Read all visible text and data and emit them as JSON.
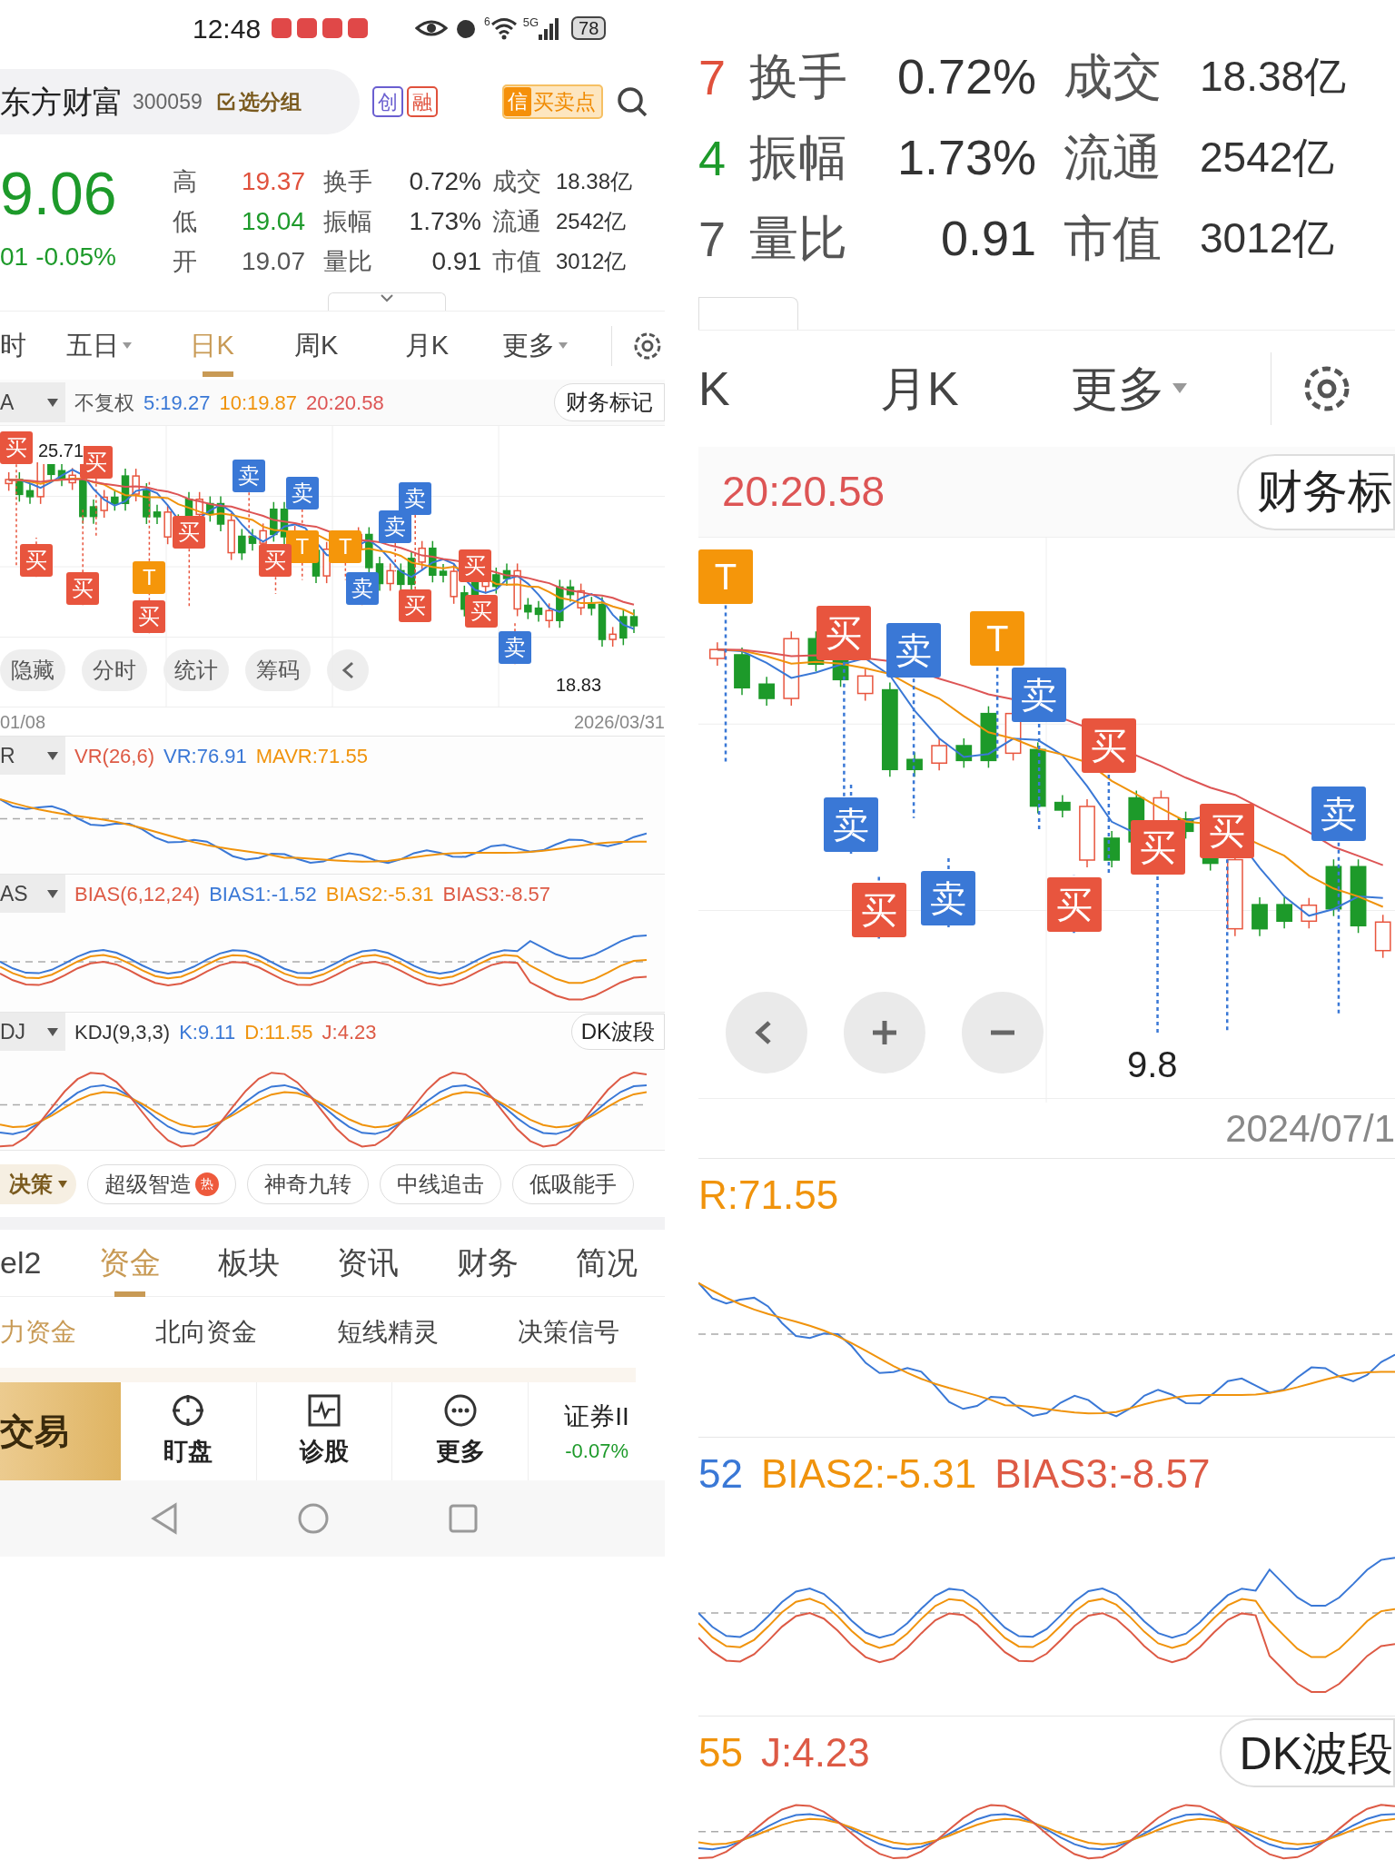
{
  "status_bar": {
    "time": "12:48",
    "network": "5G",
    "wifi_badge": "6",
    "battery": "78"
  },
  "left": {
    "header": {
      "name": "东方财富",
      "code": "300059",
      "group_button": "选分组",
      "badges": [
        {
          "label": "创",
          "color": "#6a5fd0"
        },
        {
          "label": "融",
          "color": "#e0513c"
        }
      ],
      "signal_icon_label": "信",
      "signal_button": "买卖点"
    },
    "quote": {
      "price": "9.06",
      "change": "01",
      "change_pct": "-0.05%",
      "stats": [
        [
          {
            "label": "高",
            "value": "19.37",
            "color": "#e0513c"
          },
          {
            "label": "换手",
            "value": "0.72%",
            "color": "#333333"
          },
          {
            "label": "成交",
            "value": "18.38亿",
            "color": "#333333"
          }
        ],
        [
          {
            "label": "低",
            "value": "19.04",
            "color": "#1d9a2a"
          },
          {
            "label": "振幅",
            "value": "1.73%",
            "color": "#333333"
          },
          {
            "label": "流通",
            "value": "2542亿",
            "color": "#333333"
          }
        ],
        [
          {
            "label": "开",
            "value": "19.07",
            "color": "#555555"
          },
          {
            "label": "量比",
            "value": "0.91",
            "color": "#333333"
          },
          {
            "label": "市值",
            "value": "3012亿",
            "color": "#333333"
          }
        ]
      ]
    },
    "periods": [
      {
        "label": "时",
        "selected": false,
        "dropdown": false
      },
      {
        "label": "五日",
        "selected": false,
        "dropdown": true
      },
      {
        "label": "日K",
        "selected": true,
        "dropdown": false
      },
      {
        "label": "周K",
        "selected": false,
        "dropdown": false
      },
      {
        "label": "月K",
        "selected": false,
        "dropdown": false
      },
      {
        "label": "更多",
        "selected": false,
        "dropdown": true
      }
    ],
    "chart_header": {
      "selector": "A",
      "adjust": "不复权",
      "ma": [
        {
          "text": "5:19.27",
          "color": "#3a78d6"
        },
        {
          "text": "10:19.87",
          "color": "#f0930c"
        },
        {
          "text": "20:20.58",
          "color": "#dd5555"
        }
      ],
      "button": "财务标记"
    },
    "main_chart": {
      "max_label": "25.71",
      "min_label": "18.83",
      "markers": [
        {
          "kind": "buy",
          "label": "买"
        },
        {
          "kind": "buy",
          "label": "买"
        },
        {
          "kind": "buy",
          "label": "买"
        },
        {
          "kind": "buy",
          "label": "买"
        },
        {
          "kind": "buy",
          "label": "买"
        },
        {
          "kind": "sell",
          "label": "卖"
        },
        {
          "kind": "sell",
          "label": "卖"
        },
        {
          "kind": "t",
          "label": "T"
        },
        {
          "kind": "t",
          "label": "T"
        },
        {
          "kind": "buy",
          "label": "买"
        },
        {
          "kind": "buy",
          "label": "买"
        },
        {
          "kind": "sell",
          "label": "卖"
        },
        {
          "kind": "sell",
          "label": "卖"
        },
        {
          "kind": "buy",
          "label": "买"
        },
        {
          "kind": "sell",
          "label": "卖"
        },
        {
          "kind": "buy",
          "label": "买"
        },
        {
          "kind": "buy",
          "label": "买"
        },
        {
          "kind": "t",
          "label": "T"
        },
        {
          "kind": "sell",
          "label": "卖"
        }
      ],
      "tools": [
        "隐藏",
        "分时",
        "统计",
        "筹码"
      ],
      "dates": [
        "01/08",
        "2026/03/31"
      ]
    },
    "indicators": [
      {
        "selector": "R",
        "title": {
          "text": "VR(26,6)",
          "color": "#dd5a45"
        },
        "values": [
          {
            "text": "VR:76.91",
            "color": "#3a78d6"
          },
          {
            "text": "MAVR:71.55",
            "color": "#f0930c"
          }
        ]
      },
      {
        "selector": "AS",
        "title": {
          "text": "BIAS(6,12,24)",
          "color": "#dd5a45"
        },
        "values": [
          {
            "text": "BIAS1:-1.52",
            "color": "#3a78d6"
          },
          {
            "text": "BIAS2:-5.31",
            "color": "#f0930c"
          },
          {
            "text": "BIAS3:-8.57",
            "color": "#dd5a45"
          }
        ]
      },
      {
        "selector": "DJ",
        "title": {
          "text": "KDJ(9,3,3)",
          "color": "#333333"
        },
        "values": [
          {
            "text": "K:9.11",
            "color": "#3a78d6"
          },
          {
            "text": "D:11.55",
            "color": "#f0930c"
          },
          {
            "text": "J:4.23",
            "color": "#dd5a45"
          }
        ],
        "button": "DK波段"
      }
    ],
    "strategy": {
      "dropdown": "决策",
      "chips": [
        {
          "label": "超级智造",
          "hot": "热"
        },
        {
          "label": "神奇九转"
        },
        {
          "label": "中线追击"
        },
        {
          "label": "低吸能手"
        }
      ]
    },
    "tabs": [
      {
        "label": "el2",
        "selected": false
      },
      {
        "label": "资金",
        "selected": true
      },
      {
        "label": "板块",
        "selected": false
      },
      {
        "label": "资讯",
        "selected": false
      },
      {
        "label": "财务",
        "selected": false
      },
      {
        "label": "简况",
        "selected": false
      }
    ],
    "subtabs": [
      {
        "label": "力资金",
        "selected": true
      },
      {
        "label": "北向资金",
        "selected": false
      },
      {
        "label": "短线精灵",
        "selected": false
      },
      {
        "label": "决策信号",
        "selected": false
      }
    ],
    "bottom_bar": {
      "trade": "交易",
      "actions": [
        {
          "label": "盯盘"
        },
        {
          "label": "诊股"
        },
        {
          "label": "更多"
        }
      ],
      "index_name": "证券II",
      "index_change": "-0.07%"
    }
  },
  "right": {
    "stats": [
      {
        "cut": "7",
        "color": "#e0513c",
        "pairs": [
          {
            "label": "换手",
            "value": "0.72%"
          },
          {
            "label": "成交",
            "value": "18.38亿"
          }
        ]
      },
      {
        "cut": "4",
        "color": "#1d9a2a",
        "pairs": [
          {
            "label": "振幅",
            "value": "1.73%"
          },
          {
            "label": "流通",
            "value": "2542亿"
          }
        ]
      },
      {
        "cut": "7",
        "color": "#555555",
        "pairs": [
          {
            "label": "量比",
            "value": "0.91"
          },
          {
            "label": "市值",
            "value": "3012亿"
          }
        ]
      }
    ],
    "periods": [
      {
        "label": "K",
        "dropdown": false
      },
      {
        "label": "月K",
        "dropdown": false
      },
      {
        "label": "更多",
        "dropdown": true
      }
    ],
    "ma_text": "20:20.58",
    "button": "财务标",
    "markers": [
      {
        "kind": "t",
        "label": "T"
      },
      {
        "kind": "buy",
        "label": "买"
      },
      {
        "kind": "sell",
        "label": "卖"
      },
      {
        "kind": "t",
        "label": "T"
      },
      {
        "kind": "sell",
        "label": "卖"
      },
      {
        "kind": "buy",
        "label": "买"
      },
      {
        "kind": "sell",
        "label": "卖"
      },
      {
        "kind": "buy",
        "label": "买"
      },
      {
        "kind": "sell",
        "label": "卖"
      },
      {
        "kind": "buy",
        "label": "买"
      },
      {
        "kind": "buy",
        "label": "买"
      },
      {
        "kind": "buy",
        "label": "买"
      },
      {
        "kind": "sell",
        "label": "卖"
      }
    ],
    "min_label": "9.8",
    "date": "2024/07/1",
    "vr_text": [
      {
        "text": "R:71.55",
        "color": "#f0930c"
      }
    ],
    "bias_text": [
      {
        "text": "52",
        "color": "#3a78d6"
      },
      {
        "text": "BIAS2:-5.31",
        "color": "#f0930c"
      },
      {
        "text": "BIAS3:-8.57",
        "color": "#dd5a45"
      }
    ],
    "kdj_text": [
      {
        "text": "55",
        "color": "#f0930c"
      },
      {
        "text": "J:4.23",
        "color": "#dd5a45"
      }
    ],
    "kdj_button": "DK波段"
  }
}
